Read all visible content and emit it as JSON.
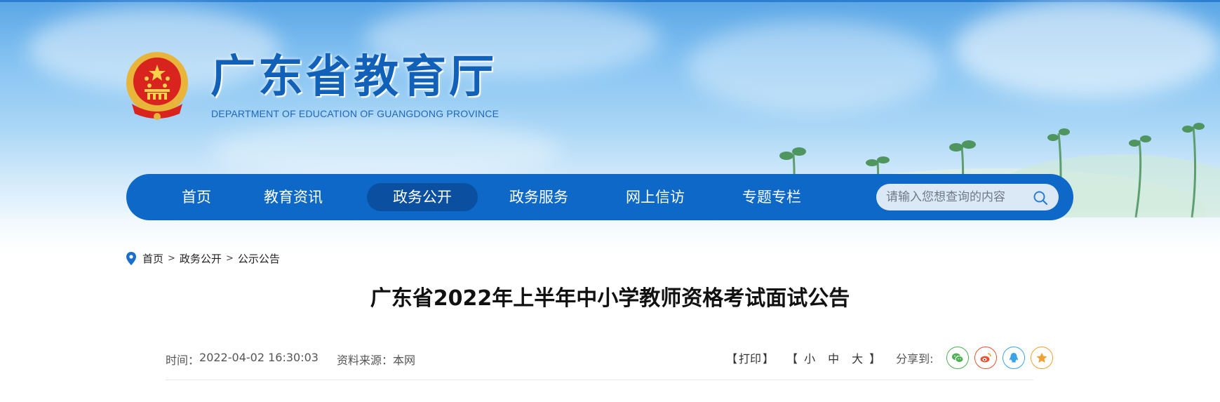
{
  "header": {
    "site_title": "广东省教育厅",
    "site_subtitle": "DEPARTMENT OF EDUCATION OF GUANGDONG PROVINCE"
  },
  "nav": {
    "items": [
      {
        "label": "首页",
        "active": false
      },
      {
        "label": "教育资讯",
        "active": false
      },
      {
        "label": "政务公开",
        "active": true
      },
      {
        "label": "政务服务",
        "active": false
      },
      {
        "label": "网上信访",
        "active": false
      },
      {
        "label": "专题专栏",
        "active": false
      }
    ],
    "search_placeholder": "请输入您想查询的内容",
    "search_icon": "search-icon"
  },
  "breadcrumb": {
    "icon": "location-pin-icon",
    "items": [
      "首页",
      "政务公开",
      "公示公告"
    ],
    "separator": ">"
  },
  "article": {
    "title": "广东省2022年上半年中小学教师资格考试面试公告",
    "time_label": "时间：",
    "time_value": "2022-04-02 16:30:03",
    "source_label": "资料来源：",
    "source_value": "本网",
    "print_label": "打印",
    "font_sizes": [
      "小",
      "中",
      "大"
    ],
    "share_label": "分享到:",
    "share_targets": [
      {
        "name": "wechat",
        "color": "#4caf50"
      },
      {
        "name": "weibo",
        "color": "#e8502f"
      },
      {
        "name": "qq",
        "color": "#3aa3e3"
      },
      {
        "name": "favorite",
        "color": "#f0a030"
      }
    ]
  },
  "colors": {
    "nav_bg": "#0d68c7",
    "nav_active_bg": "#0a4fa0",
    "title_blue": "#1261b8"
  }
}
